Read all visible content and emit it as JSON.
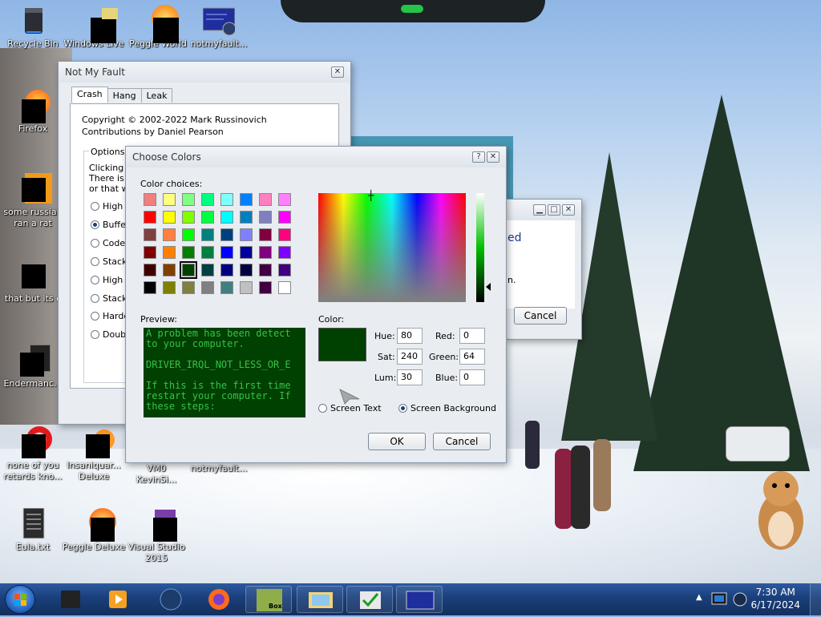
{
  "desktop": {
    "icons": [
      {
        "label": "Recycle Bin"
      },
      {
        "label": "Windows Live"
      },
      {
        "label": "Peggle World"
      },
      {
        "label": "notmyfault..."
      },
      {
        "label": "Firefox"
      },
      {
        "label": "some russian\nran a rat"
      },
      {
        "label": "that but its c"
      },
      {
        "label": "Endermanc..."
      },
      {
        "label": "none of you\nretards kno..."
      },
      {
        "label": "Insaniquar...\nDeluxe"
      },
      {
        "label": "VM0\nKevinSi..."
      },
      {
        "label": "notmyfault..."
      },
      {
        "label": "Eula.txt"
      },
      {
        "label": "Peggle Deluxe"
      },
      {
        "label": "Visual Studio\n2015"
      }
    ]
  },
  "not_my_fault": {
    "title": "Not My Fault",
    "tabs": [
      "Crash",
      "Hang",
      "Leak"
    ],
    "active_tab": "Crash",
    "copyright": "Copyright © 2002-2022 Mark Russinovich",
    "contributions": "Contributions by Daniel Pearson",
    "options_legend": "Options",
    "options_text": "Clicking th\nThere is a\nor that wo",
    "options": [
      {
        "label": "High I",
        "checked": false
      },
      {
        "label": "Buffer",
        "checked": true
      },
      {
        "label": "Code",
        "checked": false
      },
      {
        "label": "Stack",
        "checked": false
      },
      {
        "label": "High I",
        "checked": false
      },
      {
        "label": "Stack",
        "checked": false
      },
      {
        "label": "Hardc",
        "checked": false
      },
      {
        "label": "Double",
        "checked": false
      }
    ],
    "close_glyph": "✕"
  },
  "bg_window": {
    "text1": "ed",
    "text2": "n.",
    "cancel_label": "Cancel",
    "min_glyph": "▁",
    "max_glyph": "□",
    "close_glyph": "✕"
  },
  "choose_colors": {
    "title": "Choose Colors",
    "help_glyph": "?",
    "close_glyph": "✕",
    "color_choices_label": "Color choices:",
    "swatches": [
      "#f08080",
      "#ffff80",
      "#80ff80",
      "#00ff80",
      "#80ffff",
      "#0080ff",
      "#ff80c0",
      "#ff80ff",
      "#ff0000",
      "#ffff00",
      "#80ff00",
      "#00ff40",
      "#00ffff",
      "#0080c0",
      "#8080c0",
      "#ff00ff",
      "#804040",
      "#ff8040",
      "#00ff00",
      "#008080",
      "#004080",
      "#8080ff",
      "#800040",
      "#ff0080",
      "#800000",
      "#ff8000",
      "#008000",
      "#008040",
      "#0000ff",
      "#0000a0",
      "#800080",
      "#8000ff",
      "#400000",
      "#804000",
      "#004000",
      "#004040",
      "#000080",
      "#000040",
      "#400040",
      "#400080",
      "#000000",
      "#808000",
      "#808040",
      "#808080",
      "#408080",
      "#c0c0c0",
      "#400040",
      "#ffffff"
    ],
    "selected_swatch_index": 34,
    "preview_label": "Preview:",
    "preview_text": "A problem has been detect\nto your computer.\n\nDRIVER_IRQL_NOT_LESS_OR_E\n\nIf this is the first time\nrestart your computer. If\nthese steps:",
    "color_label": "Color:",
    "current_color": "#004000",
    "hue_label": "Hue:",
    "hue": "80",
    "sat_label": "Sat:",
    "sat": "240",
    "lum_label": "Lum:",
    "lum": "30",
    "red_label": "Red:",
    "red": "0",
    "green_label": "Green:",
    "green": "64",
    "blue_label": "Blue:",
    "blue": "0",
    "screen_text_label": "Screen Text",
    "screen_background_label": "Screen Background",
    "screen_background_selected": true,
    "ok_label": "OK",
    "cancel_label": "Cancel"
  },
  "taskbar": {
    "time": "7:30 AM",
    "date": "6/17/2024",
    "tray_arrow": "▲",
    "box_label": "Box"
  }
}
